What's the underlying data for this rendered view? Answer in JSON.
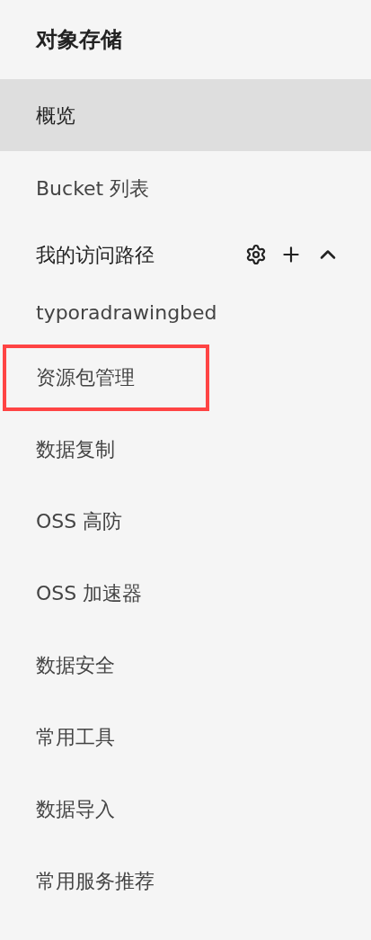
{
  "title": "对象存储",
  "items": [
    {
      "kind": "link",
      "label": "概览",
      "selected": true,
      "highlighted": false
    },
    {
      "kind": "link",
      "label": "Bucket 列表",
      "selected": false,
      "highlighted": false
    },
    {
      "kind": "group",
      "label": "我的访问路径",
      "selected": false,
      "expanded": true,
      "children": [
        {
          "label": "typoradrawingbed",
          "selected": false,
          "highlighted": false
        }
      ]
    },
    {
      "kind": "link",
      "label": "资源包管理",
      "selected": false,
      "highlighted": true
    },
    {
      "kind": "link",
      "label": "数据复制",
      "selected": false,
      "highlighted": false
    },
    {
      "kind": "link",
      "label": "OSS 高防",
      "selected": false,
      "highlighted": false
    },
    {
      "kind": "link",
      "label": "OSS 加速器",
      "selected": false,
      "highlighted": false
    },
    {
      "kind": "link",
      "label": "数据安全",
      "selected": false,
      "highlighted": false
    },
    {
      "kind": "link",
      "label": "常用工具",
      "selected": false,
      "highlighted": false
    },
    {
      "kind": "link",
      "label": "数据导入",
      "selected": false,
      "highlighted": false
    },
    {
      "kind": "link",
      "label": "常用服务推荐",
      "selected": false,
      "highlighted": false
    }
  ]
}
